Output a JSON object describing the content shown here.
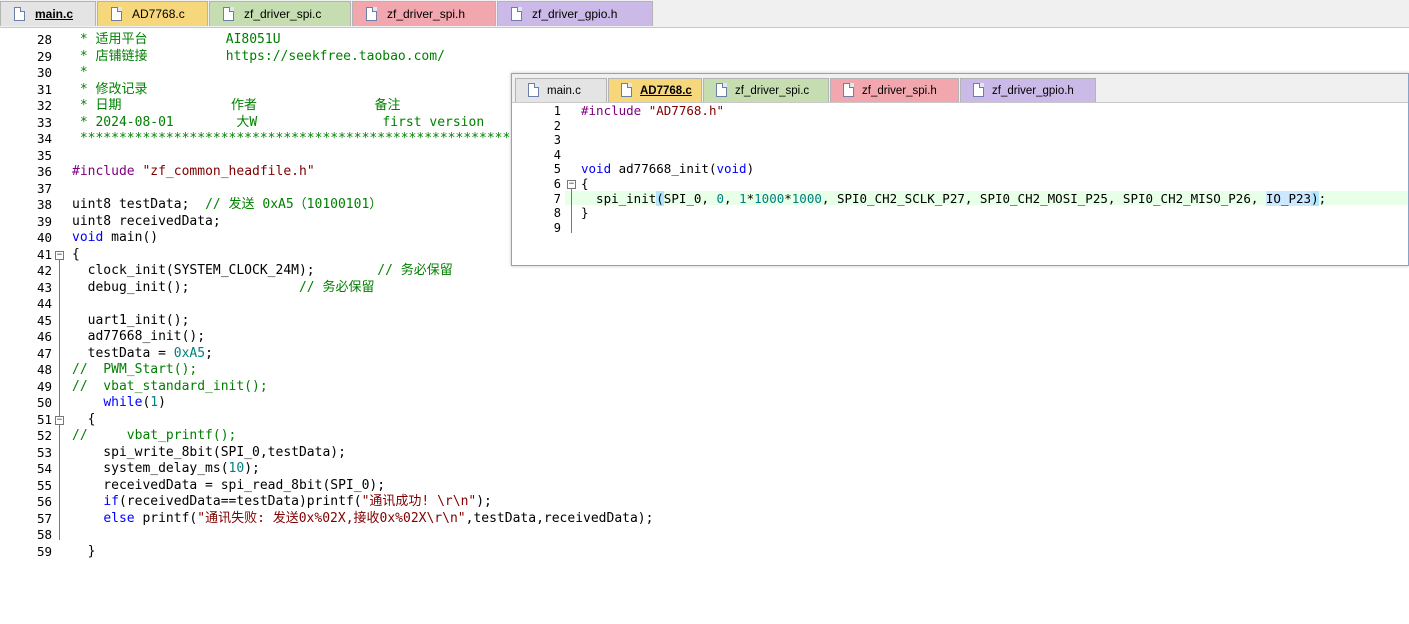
{
  "main_tabs": [
    {
      "label": "main.c",
      "color": "#e4e4e4",
      "active": true
    },
    {
      "label": "AD7768.c",
      "color": "#f7d77b",
      "active": false
    },
    {
      "label": "zf_driver_spi.c",
      "color": "#c6ddb1",
      "active": false
    },
    {
      "label": "zf_driver_spi.h",
      "color": "#f2a6ae",
      "active": false
    },
    {
      "label": "zf_driver_gpio.h",
      "color": "#cbb9e7",
      "active": false
    }
  ],
  "main_lines": [
    {
      "n": "28",
      "tokens": [
        [
          "c",
          " * 适用平台          AI8051U"
        ]
      ]
    },
    {
      "n": "29",
      "tokens": [
        [
          "c",
          " * 店铺链接          https://seekfree.taobao.com/"
        ]
      ]
    },
    {
      "n": "30",
      "tokens": [
        [
          "c",
          " *"
        ]
      ]
    },
    {
      "n": "31",
      "tokens": [
        [
          "c",
          " * 修改记录"
        ]
      ]
    },
    {
      "n": "32",
      "tokens": [
        [
          "c",
          " * 日期              作者               备注"
        ]
      ]
    },
    {
      "n": "33",
      "tokens": [
        [
          "c",
          " * 2024-08-01        大W                first version"
        ]
      ]
    },
    {
      "n": "34",
      "tokens": [
        [
          "c",
          " *************************************************************"
        ]
      ]
    },
    {
      "n": "35",
      "tokens": [
        [
          "",
          ""
        ]
      ]
    },
    {
      "n": "36",
      "tokens": [
        [
          "p",
          "#include "
        ],
        [
          "s",
          "\"zf_common_headfile.h\""
        ]
      ]
    },
    {
      "n": "37",
      "tokens": [
        [
          "",
          ""
        ]
      ]
    },
    {
      "n": "38",
      "tokens": [
        [
          "",
          "uint8 testData;  "
        ],
        [
          "c",
          "// 发送 0xA5（10100101）"
        ]
      ]
    },
    {
      "n": "39",
      "tokens": [
        [
          "",
          "uint8 receivedData;"
        ]
      ]
    },
    {
      "n": "40",
      "tokens": [
        [
          "k",
          "void"
        ],
        [
          "",
          " main()"
        ]
      ]
    },
    {
      "n": "41",
      "tokens": [
        [
          "",
          "{"
        ]
      ]
    },
    {
      "n": "42",
      "tokens": [
        [
          "",
          "  clock_init(SYSTEM_CLOCK_24M);        "
        ],
        [
          "c",
          "// 务必保留"
        ]
      ]
    },
    {
      "n": "43",
      "tokens": [
        [
          "",
          "  debug_init();              "
        ],
        [
          "c",
          "// 务必保留"
        ]
      ]
    },
    {
      "n": "44",
      "tokens": [
        [
          "",
          ""
        ]
      ]
    },
    {
      "n": "45",
      "tokens": [
        [
          "",
          "  uart1_init();"
        ]
      ]
    },
    {
      "n": "46",
      "tokens": [
        [
          "",
          "  ad77668_init();"
        ]
      ]
    },
    {
      "n": "47",
      "tokens": [
        [
          "",
          "  testData = "
        ],
        [
          "n",
          "0xA5"
        ],
        [
          "",
          ";"
        ]
      ]
    },
    {
      "n": "48",
      "tokens": [
        [
          "c",
          "//  PWM_Start();"
        ]
      ]
    },
    {
      "n": "49",
      "tokens": [
        [
          "c",
          "//  vbat_standard_init();"
        ]
      ]
    },
    {
      "n": "50",
      "tokens": [
        [
          "",
          "    "
        ],
        [
          "k",
          "while"
        ],
        [
          "",
          "("
        ],
        [
          "n",
          "1"
        ],
        [
          "",
          ")"
        ]
      ]
    },
    {
      "n": "51",
      "tokens": [
        [
          "",
          "  {"
        ]
      ]
    },
    {
      "n": "52",
      "tokens": [
        [
          "c",
          "//     vbat_printf();"
        ]
      ]
    },
    {
      "n": "53",
      "tokens": [
        [
          "",
          "    spi_write_8bit(SPI_0,testData);"
        ]
      ]
    },
    {
      "n": "54",
      "tokens": [
        [
          "",
          "    system_delay_ms("
        ],
        [
          "n",
          "10"
        ],
        [
          "",
          ");"
        ]
      ]
    },
    {
      "n": "55",
      "tokens": [
        [
          "",
          "    receivedData = spi_read_8bit(SPI_0);"
        ]
      ]
    },
    {
      "n": "56",
      "tokens": [
        [
          "",
          "    "
        ],
        [
          "k",
          "if"
        ],
        [
          "",
          "(receivedData==testData)printf("
        ],
        [
          "s",
          "\"通讯成功! \\r\\n\""
        ],
        [
          "",
          ");"
        ]
      ]
    },
    {
      "n": "57",
      "tokens": [
        [
          "",
          "    "
        ],
        [
          "k",
          "else"
        ],
        [
          "",
          " printf("
        ],
        [
          "s",
          "\"通讯失败: 发送0x%02X,接收0x%02X\\r\\n\""
        ],
        [
          "",
          ",testData,receivedData);"
        ]
      ]
    },
    {
      "n": "58",
      "tokens": [
        [
          "",
          ""
        ]
      ]
    },
    {
      "n": "59",
      "tokens": [
        [
          "",
          "  }"
        ]
      ]
    }
  ],
  "float_tabs": [
    {
      "label": "main.c",
      "color": "#e4e4e4",
      "active": false
    },
    {
      "label": "AD7768.c",
      "color": "#f7d77b",
      "active": true
    },
    {
      "label": "zf_driver_spi.c",
      "color": "#c6ddb1",
      "active": false
    },
    {
      "label": "zf_driver_spi.h",
      "color": "#f2a6ae",
      "active": false
    },
    {
      "label": "zf_driver_gpio.h",
      "color": "#cbb9e7",
      "active": false
    }
  ],
  "float_lines": [
    {
      "n": "1",
      "tokens": [
        [
          "p",
          "#include "
        ],
        [
          "s",
          "\"AD7768.h\""
        ]
      ]
    },
    {
      "n": "2",
      "tokens": [
        [
          "",
          ""
        ]
      ]
    },
    {
      "n": "3",
      "tokens": [
        [
          "",
          ""
        ]
      ]
    },
    {
      "n": "4",
      "tokens": [
        [
          "",
          ""
        ]
      ]
    },
    {
      "n": "5",
      "tokens": [
        [
          "k",
          "void"
        ],
        [
          "",
          " ad77668_init("
        ],
        [
          "k",
          "void"
        ],
        [
          "",
          ")"
        ]
      ]
    },
    {
      "n": "6",
      "tokens": [
        [
          "",
          "{"
        ]
      ]
    },
    {
      "n": "7",
      "tokens": [
        [
          "",
          "  spi_init"
        ],
        [
          "brk",
          "("
        ],
        [
          "",
          "SPI_0, "
        ],
        [
          "n",
          "0"
        ],
        [
          "",
          ", "
        ],
        [
          "n",
          "1"
        ],
        [
          "",
          "*"
        ],
        [
          "n",
          "1000"
        ],
        [
          "",
          "*"
        ],
        [
          "n",
          "1000"
        ],
        [
          "",
          ", SPI0_CH2_SCLK_P27, SPI0_CH2_MOSI_P25, SPI0_CH2_MISO_P26, "
        ],
        [
          "hl",
          "IO_P23"
        ],
        [
          "brk",
          ")"
        ],
        [
          "",
          ";"
        ]
      ]
    },
    {
      "n": "8",
      "tokens": [
        [
          "",
          "}"
        ]
      ]
    },
    {
      "n": "9",
      "tokens": [
        [
          "",
          ""
        ]
      ]
    }
  ]
}
